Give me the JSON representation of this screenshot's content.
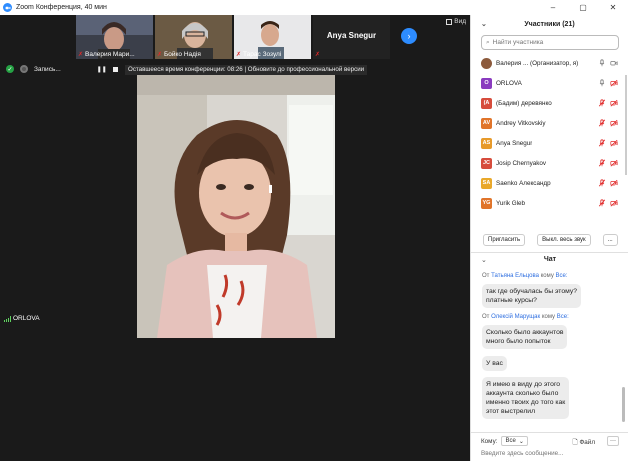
{
  "window": {
    "title": "Zoom Конференция, 40 мин",
    "controls": [
      "–",
      "▢",
      "✕"
    ]
  },
  "thumbnails": [
    {
      "name": "Валерия Мари..."
    },
    {
      "name": "Бойко Надія"
    },
    {
      "name": "Тарас Зозулі"
    },
    {
      "name": "Anya Snegur"
    }
  ],
  "view_label": "Вид",
  "recording": {
    "label": "Запись...",
    "banner": "Оставшееся время конференции: 08:26 | Обновите до профессиональной версии"
  },
  "self_view_name": "ORLOVA",
  "participants": {
    "header": "Участники (21)",
    "search_placeholder": "Найти участника",
    "items": [
      {
        "name": "Валерия ...  (Организатор, я)",
        "initials": "",
        "color": "#8c5a3c",
        "mic": "on",
        "cam": "on"
      },
      {
        "name": "ORLOVA",
        "initials": "O",
        "color": "#8a3bbf",
        "mic": "on",
        "cam": "off"
      },
      {
        "name": "(Бадим) деревянко",
        "initials": "(А",
        "color": "#d64c3c",
        "mic": "off",
        "cam": "off"
      },
      {
        "name": "Andrey Vitkovskiy",
        "initials": "AV",
        "color": "#e0742a",
        "mic": "off",
        "cam": "off"
      },
      {
        "name": "Anya Snegur",
        "initials": "AS",
        "color": "#e79a2b",
        "mic": "off",
        "cam": "off"
      },
      {
        "name": "Josip Chernyakov",
        "initials": "JC",
        "color": "#d64c3c",
        "mic": "off",
        "cam": "off"
      },
      {
        "name": "Saenko Александр",
        "initials": "SA",
        "color": "#e9a82b",
        "mic": "off",
        "cam": "off"
      },
      {
        "name": "Yurik Gleb",
        "initials": "YG",
        "color": "#e0742a",
        "mic": "off",
        "cam": "off"
      }
    ],
    "invite_label": "Пригласить",
    "mute_all_label": "Выкл. весь звук",
    "more_label": "..."
  },
  "chat": {
    "header": "Чат",
    "messages": [
      {
        "from_prefix": "От",
        "from": "Татьяна Ельцова",
        "to_prefix": "кому",
        "to": "Все:",
        "texts": [
          "так где обучалась бы этому?\nплатные курсы?"
        ]
      },
      {
        "from_prefix": "От",
        "from": "Олексій Марущак",
        "to_prefix": "кому",
        "to": "Все:",
        "texts": [
          "Сколько было аккаунтов\nмного было попыток",
          "У вас",
          "Я имею в виду до этого\nаккаунта сколько было\nименно твоих  до того как\nэтот выстрелил"
        ]
      }
    ],
    "to_label": "Кому:",
    "to_value": "Все",
    "file_label": "Файл",
    "more_label": "···",
    "input_placeholder": "Введите здесь сообщение..."
  },
  "colors": {
    "accent": "#2d8cff",
    "muted_red": "#e02828",
    "secure_green": "#25a244"
  }
}
